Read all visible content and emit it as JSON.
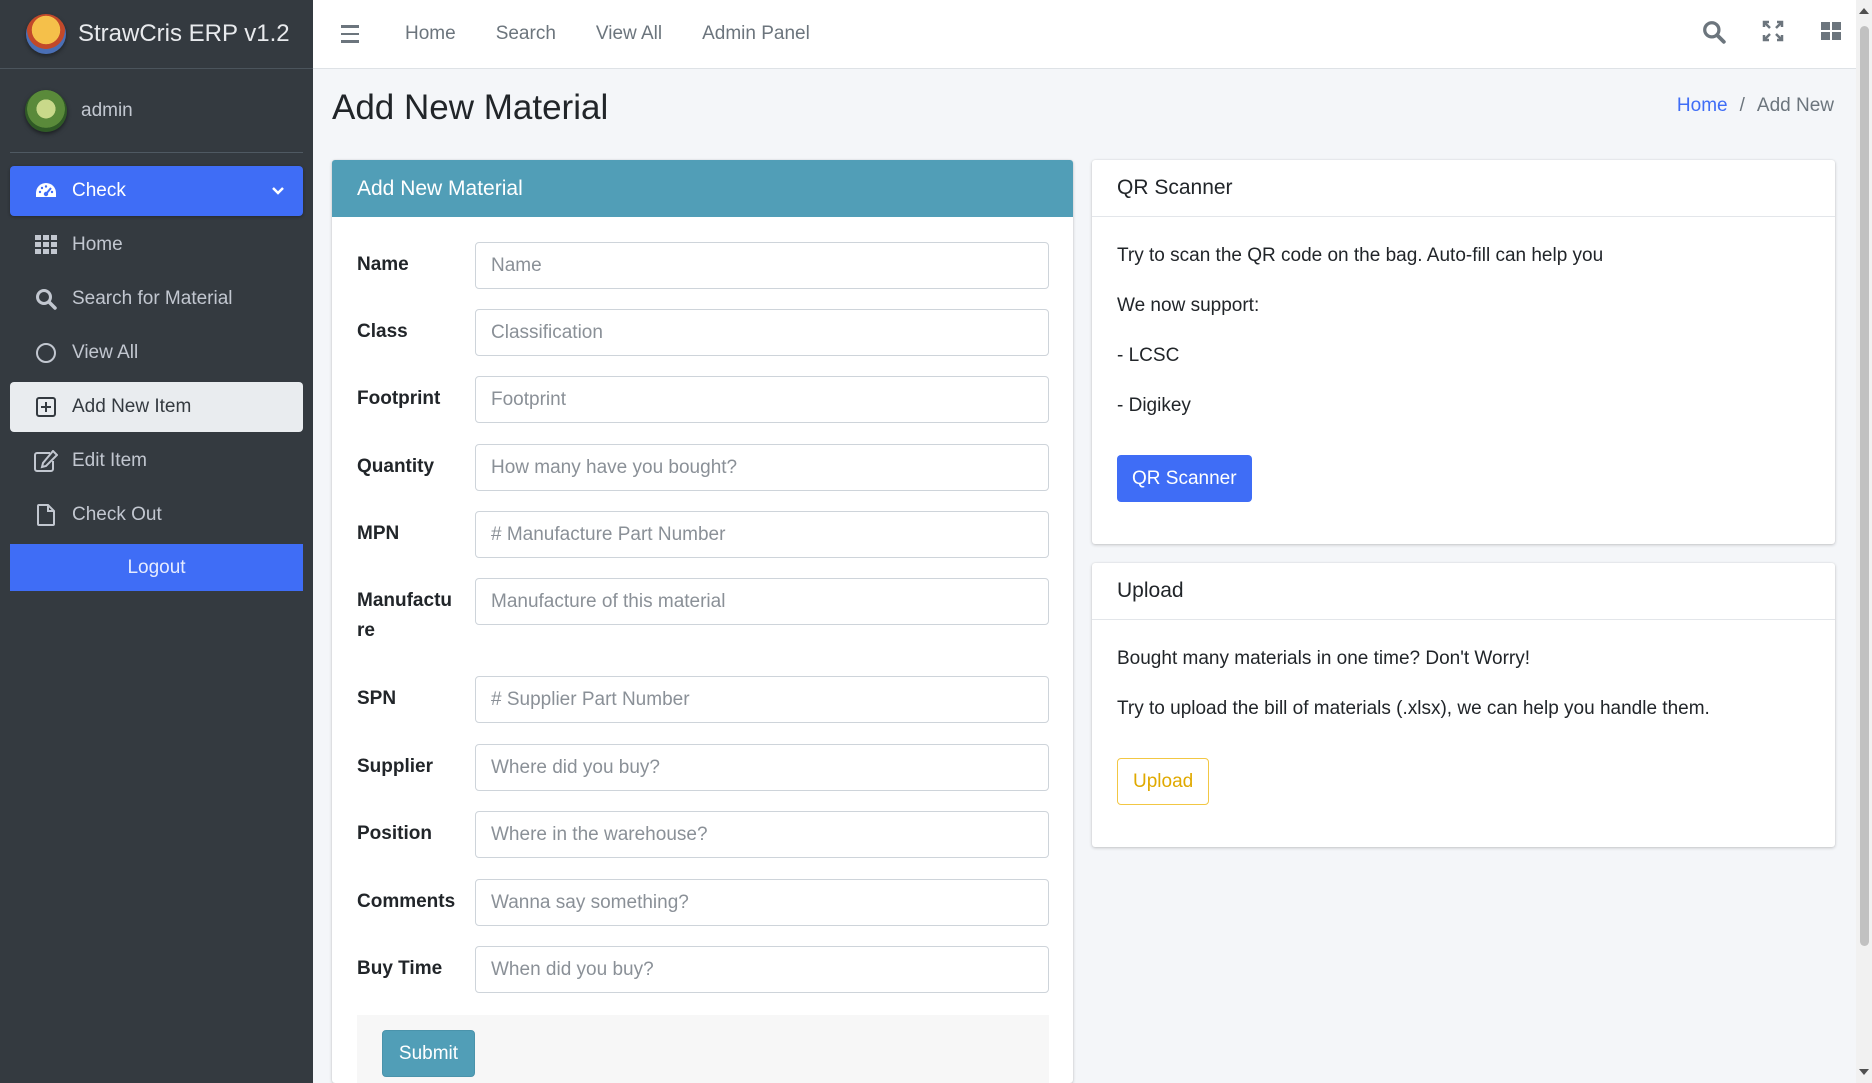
{
  "app": {
    "title": "StrawCris ERP v1.2"
  },
  "user": {
    "name": "admin"
  },
  "sidebar": {
    "items": [
      {
        "label": "Check",
        "icon": "dashboard-icon"
      },
      {
        "label": "Home",
        "icon": "grid-icon"
      },
      {
        "label": "Search for Material",
        "icon": "search-icon"
      },
      {
        "label": "View All",
        "icon": "circle-icon"
      },
      {
        "label": "Add New Item",
        "icon": "plus-square-icon"
      },
      {
        "label": "Edit Item",
        "icon": "edit-icon"
      },
      {
        "label": "Check Out",
        "icon": "file-icon"
      }
    ],
    "logout": "Logout"
  },
  "topbar": {
    "links": [
      "Home",
      "Search",
      "View All",
      "Admin Panel"
    ]
  },
  "page": {
    "title": "Add New Material",
    "breadcrumb": {
      "home": "Home",
      "sep": "/",
      "current": "Add New"
    }
  },
  "form": {
    "header": "Add New Material",
    "fields": [
      {
        "label": "Name",
        "placeholder": "Name"
      },
      {
        "label": "Class",
        "placeholder": "Classification"
      },
      {
        "label": "Footprint",
        "placeholder": "Footprint"
      },
      {
        "label": "Quantity",
        "placeholder": "How many have you bought?"
      },
      {
        "label": "MPN",
        "placeholder": "# Manufacture Part Number"
      },
      {
        "label": "Manufacture",
        "placeholder": "Manufacture of this material"
      },
      {
        "label": "SPN",
        "placeholder": "# Supplier Part Number"
      },
      {
        "label": "Supplier",
        "placeholder": "Where did you buy?"
      },
      {
        "label": "Position",
        "placeholder": "Where in the warehouse?"
      },
      {
        "label": "Comments",
        "placeholder": "Wanna say something?"
      },
      {
        "label": "Buy Time",
        "placeholder": "When did you buy?"
      }
    ],
    "submit": "Submit"
  },
  "qr": {
    "title": "QR Scanner",
    "lines": [
      "Try to scan the QR code on the bag. Auto-fill can help you",
      "We now support:",
      "- LCSC",
      "- Digikey"
    ],
    "button": "QR Scanner"
  },
  "upload": {
    "title": "Upload",
    "lines": [
      "Bought many materials in one time? Don't Worry!",
      "Try to upload the bill of materials (.xlsx), we can help you handle them."
    ],
    "button": "Upload"
  },
  "colors": {
    "accent": "#3f6df6",
    "teal": "#519eb7",
    "sidebar": "#343a40",
    "warning": "#f2c744"
  }
}
